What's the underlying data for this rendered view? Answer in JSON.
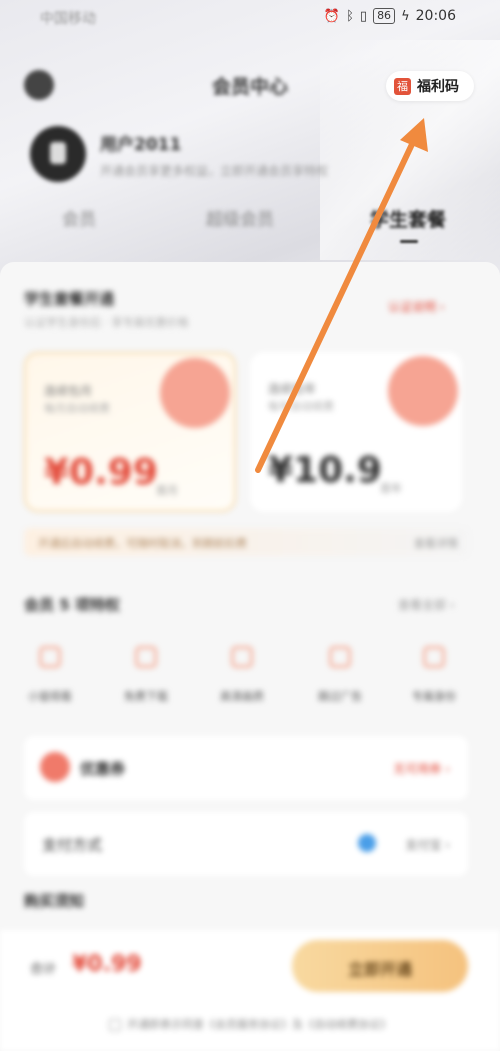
{
  "status_bar": {
    "carrier": "中国移动",
    "battery": "86",
    "time": "20:06",
    "icons": [
      "alarm-icon",
      "bluetooth-icon",
      "vibrate-icon",
      "battery-icon",
      "charging-icon"
    ]
  },
  "header": {
    "title": "会员中心",
    "welfare_badge": "福",
    "welfare_label": "福利码"
  },
  "profile": {
    "name": "用户2011",
    "subtitle": "开通会员享更多权益，立即开通会员享特权"
  },
  "tabs": [
    {
      "label": "会员"
    },
    {
      "label": "超级会员"
    },
    {
      "label": "学生套餐"
    }
  ],
  "plans_section": {
    "title": "学生套餐开通",
    "subtitle": "认证学生身份后 · 享专属优惠价格",
    "link": "认证说明 ›"
  },
  "plans": [
    {
      "name": "连续包月",
      "desc": "每月自动续费",
      "price": "¥0.99",
      "tag": "首月"
    },
    {
      "name": "连续包年",
      "desc": "每年自动续费",
      "price": "¥10.9",
      "tag": "首年"
    }
  ],
  "promo": {
    "text": "开通后自动续费，可随时取消，到期前扣费",
    "link": "查看详情"
  },
  "perks_section": {
    "title": "会员 5 项特权",
    "link": "查看全部 ›"
  },
  "perks": [
    {
      "label": "小窗观看"
    },
    {
      "label": "免费下载"
    },
    {
      "label": "高清画质"
    },
    {
      "label": "跳过广告"
    },
    {
      "label": "专属身份"
    }
  ],
  "rows": [
    {
      "label": "优惠券",
      "value": "无可用券 ›"
    },
    {
      "label": "支付方式",
      "value": "支付宝 ›"
    }
  ],
  "notice_title": "购买须知",
  "pay": {
    "total_label": "合计",
    "total": "¥0.99",
    "button": "立即开通",
    "agreement": "开通即表示同意《会员服务协议》及《自动续费协议》"
  },
  "colors": {
    "accent_red": "#e34b3b",
    "arrow_orange": "#f08a3e",
    "pay_button": "#f5c27e"
  }
}
